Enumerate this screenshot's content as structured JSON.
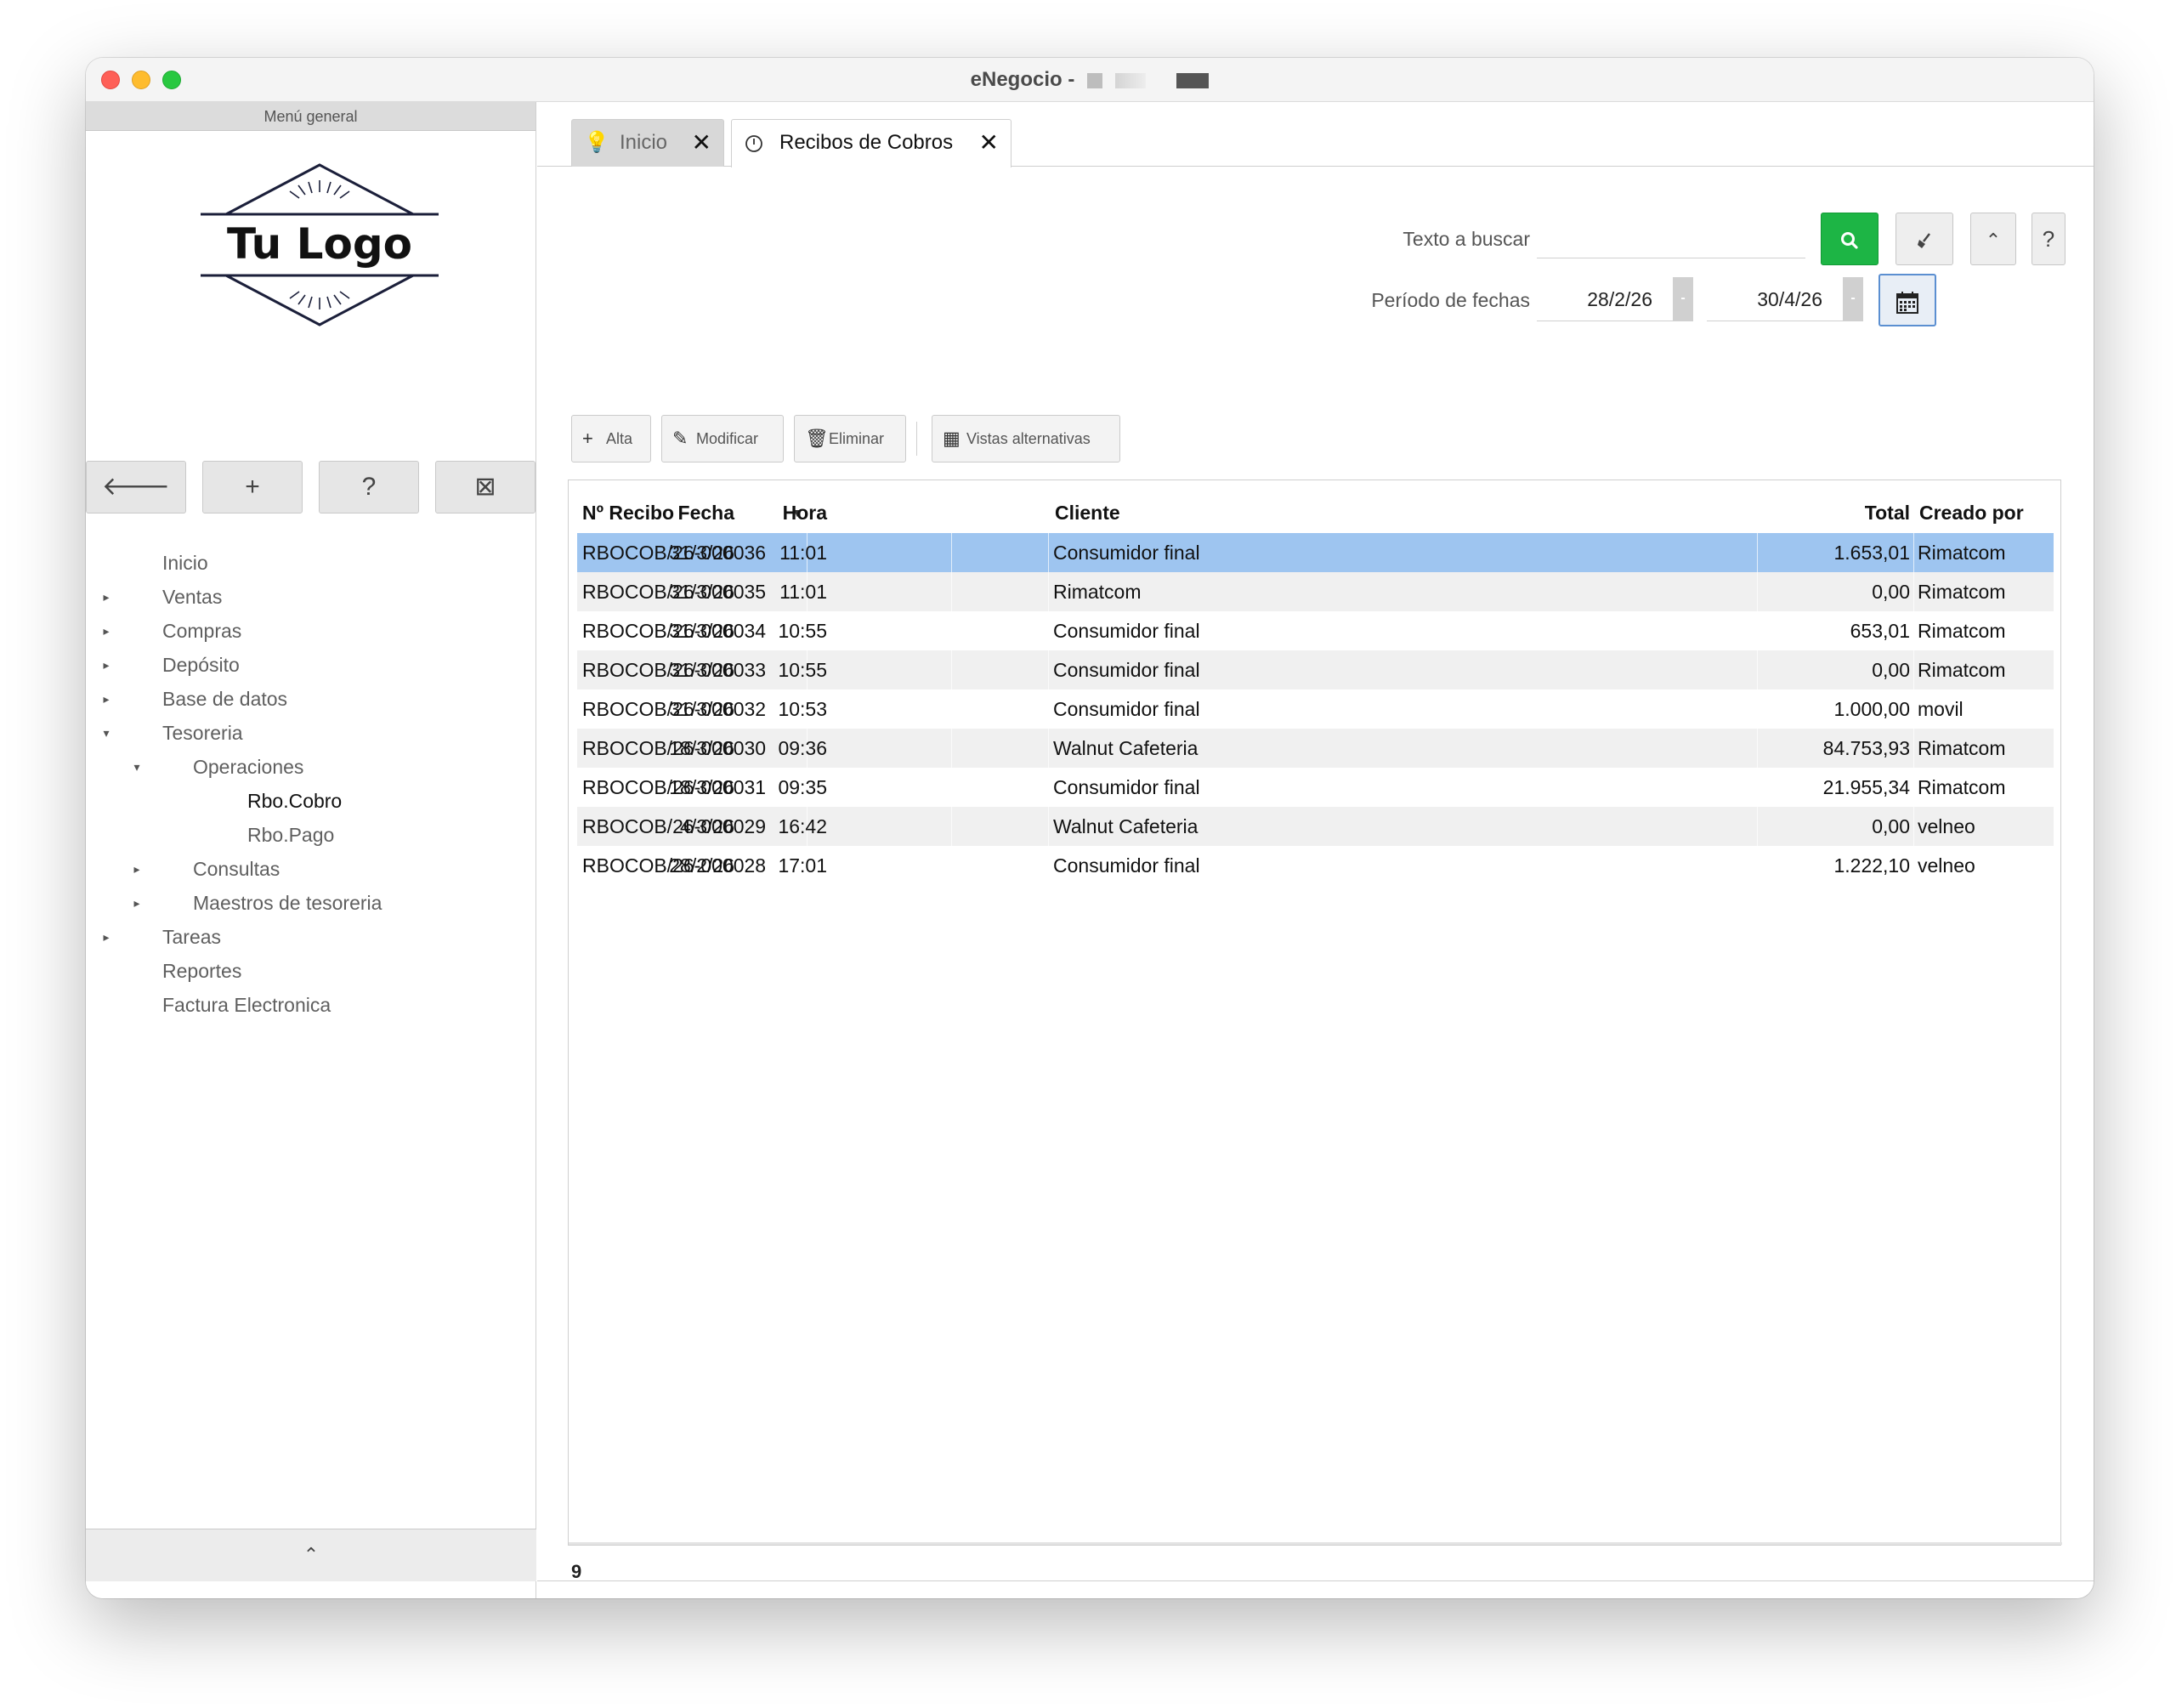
{
  "window": {
    "title": "eNegocio -"
  },
  "sidebar": {
    "header": "Menú general",
    "logo_text": "Tu Logo",
    "buttons": [
      {
        "icon": "arrow-left-icon",
        "glyph": "🡐"
      },
      {
        "icon": "plus-icon",
        "glyph": "+"
      },
      {
        "icon": "help-icon",
        "glyph": "?"
      },
      {
        "icon": "collapse-icon",
        "glyph": "⊠"
      }
    ],
    "tree": [
      {
        "label": "Inicio",
        "level": 0,
        "arrow": ""
      },
      {
        "label": "Ventas",
        "level": 0,
        "arrow": "▸"
      },
      {
        "label": "Compras",
        "level": 0,
        "arrow": "▸"
      },
      {
        "label": "Depósito",
        "level": 0,
        "arrow": "▸"
      },
      {
        "label": "Base de datos",
        "level": 0,
        "arrow": "▸"
      },
      {
        "label": "Tesoreria",
        "level": 0,
        "arrow": "▾"
      },
      {
        "label": "Operaciones",
        "level": 1,
        "arrow": "▾"
      },
      {
        "label": "Rbo.Cobro",
        "level": 2,
        "arrow": "",
        "active": true
      },
      {
        "label": "Rbo.Pago",
        "level": 2,
        "arrow": ""
      },
      {
        "label": "Consultas",
        "level": 1,
        "arrow": "▸"
      },
      {
        "label": "Maestros de tesoreria",
        "level": 1,
        "arrow": "▸"
      },
      {
        "label": "Tareas",
        "level": 0,
        "arrow": "▸"
      },
      {
        "label": "Reportes",
        "level": 0,
        "arrow": ""
      },
      {
        "label": "Factura Electronica",
        "level": 0,
        "arrow": ""
      }
    ],
    "footer_glyph": "⌃"
  },
  "tabs": [
    {
      "label": "Inicio",
      "icon": "bulb-icon",
      "close": "✕"
    },
    {
      "label": "Recibos de Cobros",
      "icon": "receipt-icon",
      "close": "✕"
    }
  ],
  "search": {
    "text_label": "Texto a buscar",
    "text_value": "",
    "period_label": "Período de fechas",
    "date_from": "28/2/26",
    "date_to": "30/4/26",
    "stepper_glyph": "-"
  },
  "toolbar": {
    "alta": "Alta",
    "modificar": "Modificar",
    "eliminar": "Eliminar",
    "vistas": "Vistas alternativas"
  },
  "table": {
    "columns": [
      "Nº Recibo",
      "Fecha",
      "Hora",
      "Cliente",
      "Total",
      "Creado por"
    ],
    "rows": [
      {
        "num": "RBOCOB/26-000036",
        "fecha": "31/3/26",
        "hora": "11:01",
        "cliente": "Consumidor final",
        "total": "1.653,01",
        "creado": "Rimatcom"
      },
      {
        "num": "RBOCOB/26-000035",
        "fecha": "31/3/26",
        "hora": "11:01",
        "cliente": "Rimatcom",
        "total": "0,00",
        "creado": "Rimatcom"
      },
      {
        "num": "RBOCOB/26-000034",
        "fecha": "31/3/26",
        "hora": "10:55",
        "cliente": "Consumidor final",
        "total": "653,01",
        "creado": "Rimatcom"
      },
      {
        "num": "RBOCOB/26-000033",
        "fecha": "31/3/26",
        "hora": "10:55",
        "cliente": "Consumidor final",
        "total": "0,00",
        "creado": "Rimatcom"
      },
      {
        "num": "RBOCOB/26-000032",
        "fecha": "31/3/26",
        "hora": "10:53",
        "cliente": "Consumidor final",
        "total": "1.000,00",
        "creado": "movil"
      },
      {
        "num": "RBOCOB/26-000030",
        "fecha": "18/3/26",
        "hora": "09:36",
        "cliente": "Walnut Cafeteria",
        "total": "84.753,93",
        "creado": "Rimatcom"
      },
      {
        "num": "RBOCOB/26-000031",
        "fecha": "18/3/26",
        "hora": "09:35",
        "cliente": "Consumidor final",
        "total": "21.955,34",
        "creado": "Rimatcom"
      },
      {
        "num": "RBOCOB/26-000029",
        "fecha": "4/3/26",
        "hora": "16:42",
        "cliente": "Walnut Cafeteria",
        "total": "0,00",
        "creado": "velneo"
      },
      {
        "num": "RBOCOB/26-000028",
        "fecha": "28/2/26",
        "hora": "17:01",
        "cliente": "Consumidor final",
        "total": "1.222,10",
        "creado": "velneo"
      }
    ],
    "count": "9"
  },
  "colors": {
    "selected_row": "#9ec5f0",
    "search_button": "#1db545",
    "accent_border": "#5b8fd1"
  }
}
